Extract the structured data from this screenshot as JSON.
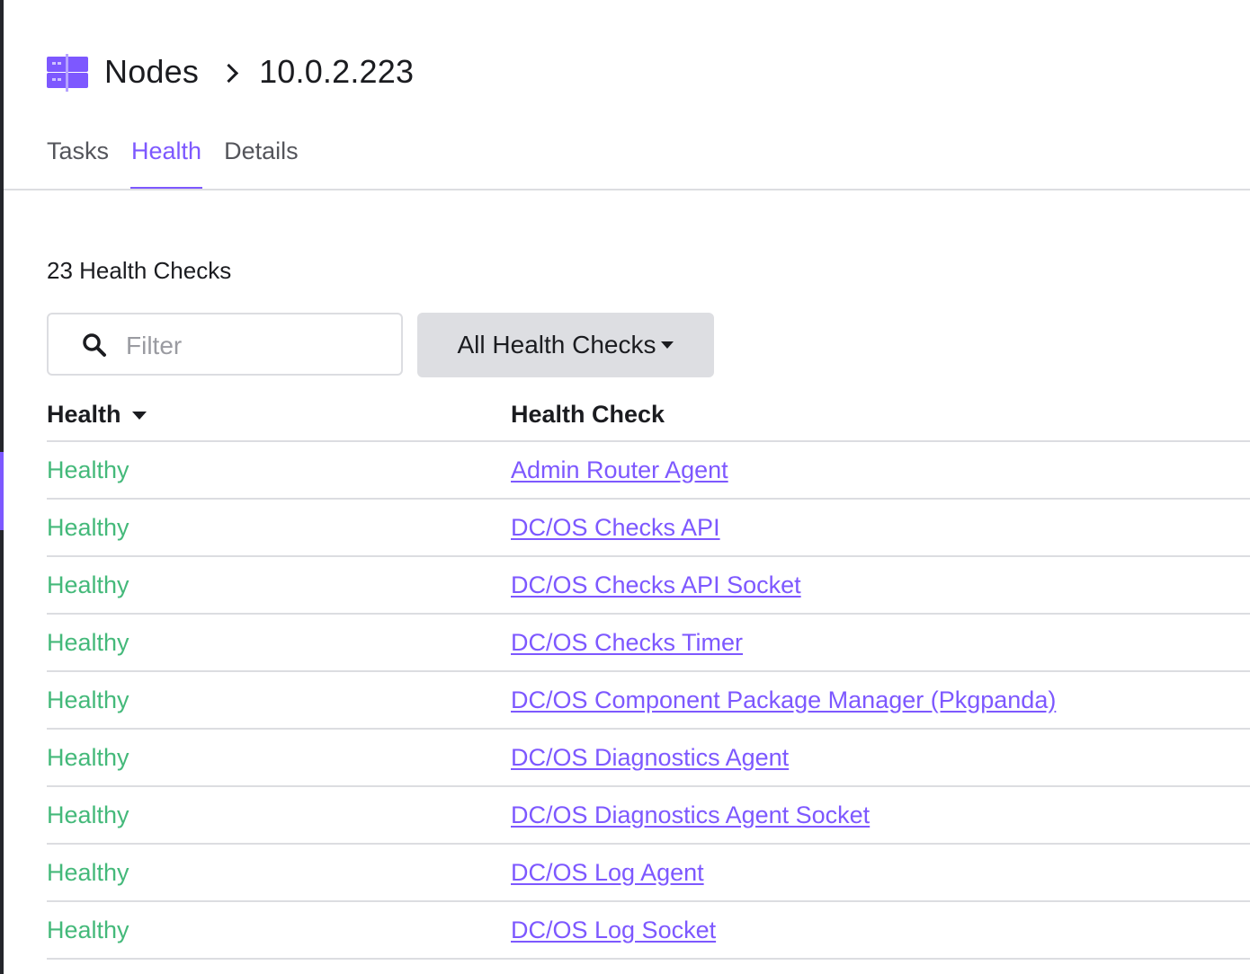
{
  "breadcrumb": {
    "icon": "nodes-icon",
    "root": "Nodes",
    "separator_icon": "chevron-right-icon",
    "current": "10.0.2.223"
  },
  "tabs": [
    {
      "label": "Tasks",
      "active": false
    },
    {
      "label": "Health",
      "active": true
    },
    {
      "label": "Details",
      "active": false
    }
  ],
  "health_count_label": "23 Health Checks",
  "filter": {
    "icon": "search-icon",
    "placeholder": "Filter",
    "value": ""
  },
  "dropdown": {
    "label": "All Health Checks",
    "icon": "caret-down-icon"
  },
  "table": {
    "columns": [
      {
        "label": "Health",
        "sort_icon": "caret-down-icon"
      },
      {
        "label": "Health Check"
      }
    ],
    "rows": [
      {
        "status": "Healthy",
        "check": "Admin Router Agent"
      },
      {
        "status": "Healthy",
        "check": "DC/OS Checks API"
      },
      {
        "status": "Healthy",
        "check": "DC/OS Checks API Socket"
      },
      {
        "status": "Healthy",
        "check": "DC/OS Checks Timer"
      },
      {
        "status": "Healthy",
        "check": "DC/OS Component Package Manager (Pkgpanda)"
      },
      {
        "status": "Healthy",
        "check": "DC/OS Diagnostics Agent"
      },
      {
        "status": "Healthy",
        "check": "DC/OS Diagnostics Agent Socket"
      },
      {
        "status": "Healthy",
        "check": "DC/OS Log Agent"
      },
      {
        "status": "Healthy",
        "check": "DC/OS Log Socket"
      }
    ]
  },
  "colors": {
    "accent": "#7d58ff",
    "healthy": "#44b97a",
    "text": "#1b1c20",
    "muted": "#54555b",
    "divider": "#dcdde1",
    "button_bg": "#dddee2"
  }
}
